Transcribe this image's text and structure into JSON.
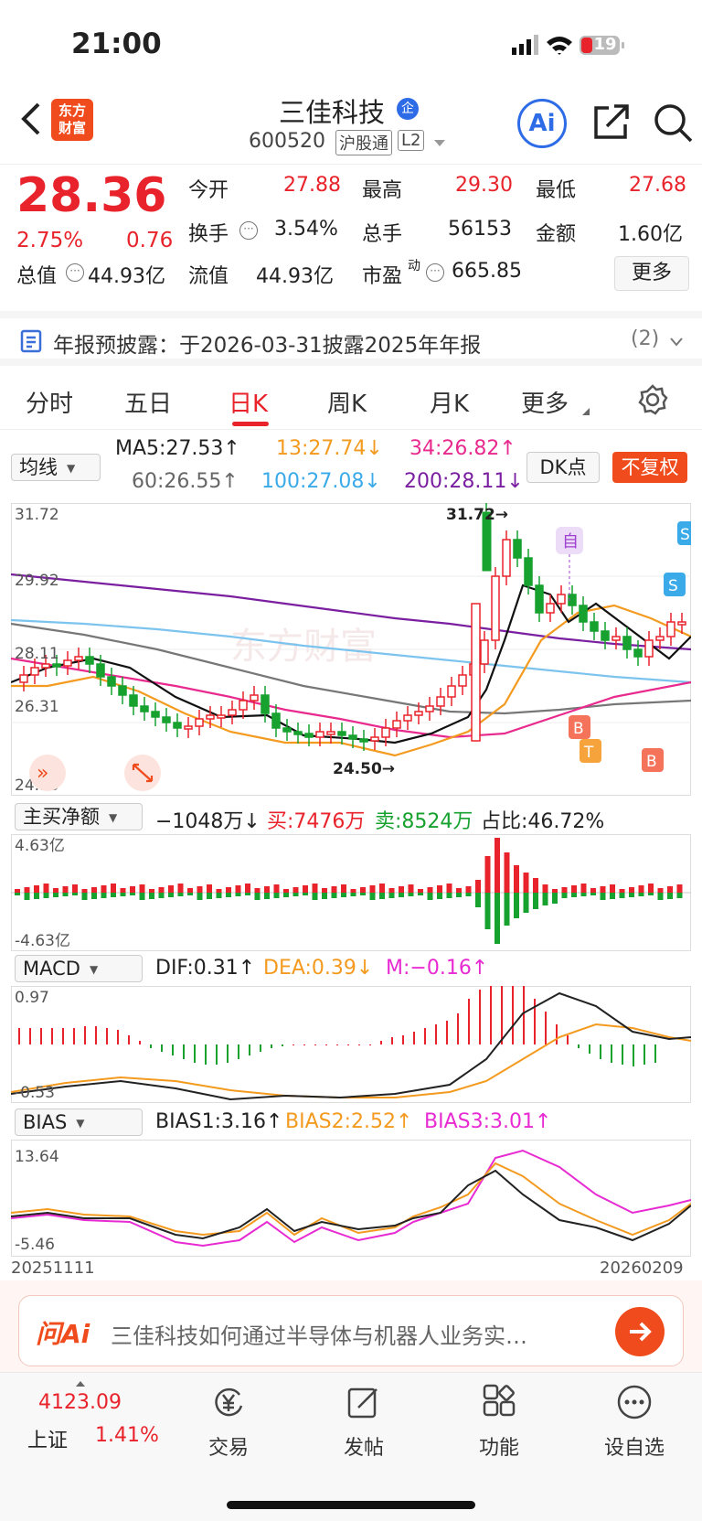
{
  "status": {
    "time": "21:00",
    "battery": "19"
  },
  "header": {
    "title": "三佳科技",
    "badge": "企",
    "code": "600520",
    "market_tag": "沪股通",
    "level_tag": "L2",
    "ai_label": "Ai",
    "logo_line1": "东方",
    "logo_line2": "财富"
  },
  "quote": {
    "price": "28.36",
    "change_pct": "2.75%",
    "change": "0.76",
    "open_label": "今开",
    "open": "27.88",
    "high_label": "最高",
    "high": "29.30",
    "low_label": "最低",
    "low": "27.68",
    "turnover_label": "换手",
    "turnover": "3.54%",
    "volume_label": "总手",
    "volume": "56153",
    "amount_label": "金额",
    "amount": "1.60亿",
    "mcap_label": "总值",
    "mcap": "44.93亿",
    "float_label": "流值",
    "float": "44.93亿",
    "pe_label": "市盈",
    "pe_sup": "动",
    "pe": "665.85",
    "more": "更多"
  },
  "notice": {
    "text": "年报预披露：于2026-03-31披露2025年年报",
    "count": "(2)"
  },
  "tabs": [
    "分时",
    "五日",
    "日K",
    "周K",
    "月K",
    "更多"
  ],
  "active_tab": "日K",
  "ma": {
    "selector": "均线",
    "ma5": "MA5:27.53↑",
    "ma13": "13:27.74↓",
    "ma34": "34:26.82↑",
    "ma60": "60:26.55↑",
    "ma100": "100:27.08↓",
    "ma200": "200:28.11↓",
    "dk_button": "DK点",
    "adj_button": "不复权"
  },
  "kline_axis": {
    "y1": "31.72",
    "y2": "29.92",
    "y3": "28.11",
    "y4": "26.31",
    "y5": "24.50",
    "max_note": "31.72→",
    "min_note": "24.50→",
    "watermark": "东方财富"
  },
  "markers": {
    "self": "自",
    "s1": "S",
    "s2": "S",
    "b1": "B",
    "b2": "B",
    "t": "T"
  },
  "netflow": {
    "selector": "主买净额",
    "net": "−1048万↓",
    "buy": "买:7476万",
    "sell": "卖:8524万",
    "ratio": "占比:46.72%",
    "top": "4.63亿",
    "bottom": "-4.63亿"
  },
  "macd": {
    "selector": "MACD",
    "dif": "DIF:0.31↑",
    "dea": "DEA:0.39↓",
    "m": "M:−0.16↑",
    "top": "0.97",
    "bottom": "-0.53"
  },
  "bias": {
    "selector": "BIAS",
    "b1": "BIAS1:3.16↑",
    "b2": "BIAS2:2.52↑",
    "b3": "BIAS3:3.01↑",
    "top": "13.64",
    "bottom": "-5.46"
  },
  "dates": {
    "start": "20251111",
    "end": "20260209"
  },
  "ai_bar": {
    "logo": "问Ai",
    "prompt": "三佳科技如何通过半导体与机器人业务实…"
  },
  "tabbar": {
    "index_value": "4123.09",
    "index_name": "上证",
    "index_change": "1.41%",
    "trade": "交易",
    "post": "发帖",
    "func": "功能",
    "watch": "设自选"
  },
  "colors": {
    "up": "#e8232b",
    "down": "#17a12f",
    "ma5": "#111111",
    "ma13": "#f39a1f",
    "ma34": "#e82a8e",
    "ma60": "#777777",
    "ma100": "#7cc4ee",
    "ma200": "#7a1fa0"
  }
}
